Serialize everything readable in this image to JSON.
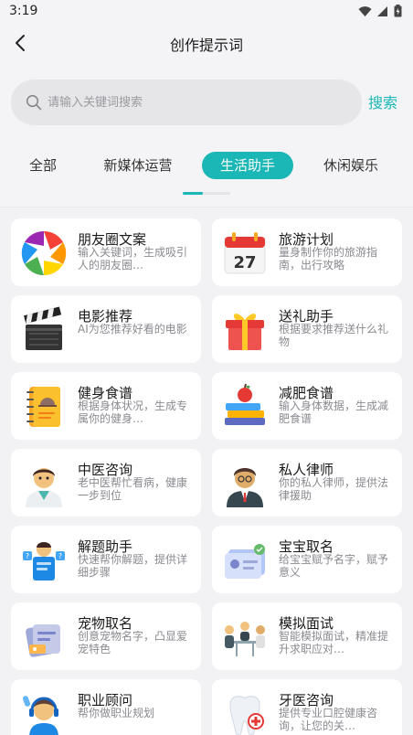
{
  "status": {
    "time": "3:19"
  },
  "navbar": {
    "title": "创作提示词"
  },
  "search": {
    "placeholder": "请输入关键词搜索",
    "button": "搜索"
  },
  "tabs": [
    {
      "label": "全部",
      "active": false
    },
    {
      "label": "新媒体运营",
      "active": false
    },
    {
      "label": "生活助手",
      "active": true
    },
    {
      "label": "休闲娱乐",
      "active": false
    }
  ],
  "cards": [
    {
      "title": "朋友圈文案",
      "desc": "输入关键词，生成吸引人的朋友圈…",
      "icon": "camera-aperture-icon"
    },
    {
      "title": "旅游计划",
      "desc": "量身制作你的旅游指南，出行攻略",
      "icon": "calendar-icon",
      "icon_text": "27"
    },
    {
      "title": "电影推荐",
      "desc": "AI为您推荐好看的电影",
      "icon": "clapperboard-icon"
    },
    {
      "title": "送礼助手",
      "desc": "根据要求推荐送什么礼物",
      "icon": "gift-box-icon"
    },
    {
      "title": "健身食谱",
      "desc": "根据身体状况，生成专属你的健身…",
      "icon": "recipe-book-icon"
    },
    {
      "title": "减肥食谱",
      "desc": "输入身体数据，生成减肥食谱",
      "icon": "books-apple-icon"
    },
    {
      "title": "中医咨询",
      "desc": "老中医帮忙看病，健康一步到位",
      "icon": "doctor-avatar-icon"
    },
    {
      "title": "私人律师",
      "desc": "你的私人律师，提供法律援助",
      "icon": "lawyer-avatar-icon"
    },
    {
      "title": "解题助手",
      "desc": "快速帮你解题，提供详细步骤",
      "icon": "question-helper-icon"
    },
    {
      "title": "宝宝取名",
      "desc": "给宝宝赋予名字，赋予意义",
      "icon": "id-card-icon"
    },
    {
      "title": "宠物取名",
      "desc": "创意宠物名字，凸显爱宠特色",
      "icon": "pet-tag-icon"
    },
    {
      "title": "模拟面试",
      "desc": "智能模拟面试，精准提升求职应对…",
      "icon": "interview-icon"
    },
    {
      "title": "职业顾问",
      "desc": "帮你做职业规划",
      "icon": "headset-advisor-icon"
    },
    {
      "title": "牙医咨询",
      "desc": "提供专业口腔健康咨询，让您的关…",
      "icon": "tooth-icon"
    }
  ]
}
